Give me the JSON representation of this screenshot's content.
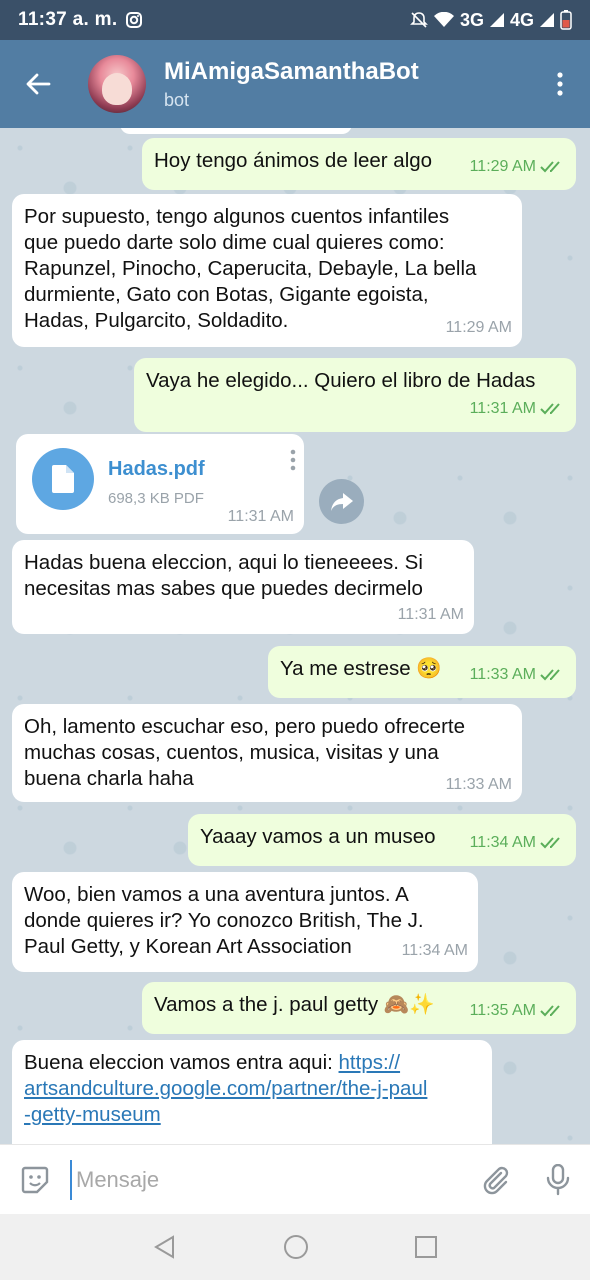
{
  "status": {
    "time": "11:37 a. m.",
    "net1": "3G",
    "net2": "4G"
  },
  "header": {
    "name": "MiAmigaSamanthaBot",
    "subtitle": "bot"
  },
  "messages": [
    {
      "text": "Hoy tengo ánimos de leer algo",
      "time": "11:29 AM"
    },
    {
      "text": "Por supuesto, tengo algunos cuentos infantiles\nque puedo darte solo dime cual quieres como:\nRapunzel, Pinocho, Caperucita, Debayle, La bella\ndurmiente, Gato con Botas, Gigante egoista,\nHadas, Pulgarcito, Soldadito.",
      "time": "11:29 AM"
    },
    {
      "text": "Vaya he elegido... Quiero el libro de Hadas",
      "time": "11:31 AM"
    },
    {
      "text": "Hadas buena eleccion, aqui lo tieneeees. Si\nnecesitas mas sabes que puedes decirmelo",
      "time": "11:31 AM"
    },
    {
      "text": "Ya me estrese 🥺",
      "time": "11:33 AM"
    },
    {
      "text": "Oh, lamento escuchar eso, pero puedo ofrecerte\nmuchas cosas, cuentos, musica, visitas y una\nbuena charla haha",
      "time": "11:33 AM"
    },
    {
      "text": "Yaaay vamos a un museo",
      "time": "11:34 AM"
    },
    {
      "text": "Woo, bien vamos a una aventura juntos. A\ndonde quieres ir? Yo conozco British, The J.\nPaul Getty, y Korean Art Association",
      "time": "11:34 AM"
    },
    {
      "text": "Vamos a the j. paul getty 🙈✨",
      "time": "11:35 AM"
    },
    {
      "text": "Buena eleccion vamos entra aqui: ",
      "link": "https://\nartsandculture.google.com/partner/the-j-paul\n-getty-museum"
    }
  ],
  "file": {
    "name": "Hadas.pdf",
    "size": "698,3 KB PDF",
    "time": "11:31 AM"
  },
  "composer": {
    "placeholder": "Mensaje"
  },
  "icons": {
    "back": "arrow-left-icon",
    "menu": "more-vert-icon",
    "emoji": "sticker-icon",
    "attach": "paperclip-icon",
    "mic": "microphone-icon",
    "share": "share-icon",
    "file": "document-icon",
    "read": "double-check-icon"
  },
  "colors": {
    "header": "#527da3",
    "statusbar": "#3a5068",
    "outgoing": "#effedd",
    "incoming": "#ffffff",
    "accent": "#3d8fd0"
  }
}
